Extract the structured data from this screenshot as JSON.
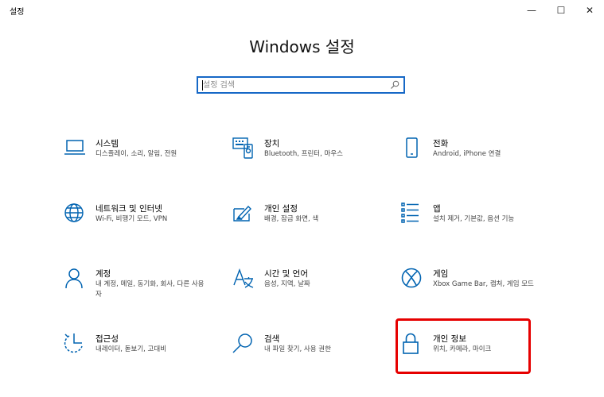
{
  "window": {
    "title": "설정",
    "minimize_glyph": "—",
    "maximize_glyph": "☐",
    "close_glyph": "✕"
  },
  "header": {
    "title": "Windows 설정"
  },
  "search": {
    "placeholder": "설정 검색",
    "value": ""
  },
  "colors": {
    "accent": "#1668c6",
    "highlight": "#e60000"
  },
  "tiles": [
    {
      "icon": "laptop-icon",
      "title": "시스템",
      "desc": "디스플레이, 소리, 알림, 전원"
    },
    {
      "icon": "keyboard-icon",
      "title": "장치",
      "desc": "Bluetooth, 프린터, 마우스"
    },
    {
      "icon": "phone-icon",
      "title": "전화",
      "desc": "Android, iPhone 연결"
    },
    {
      "icon": "globe-icon",
      "title": "네트워크 및 인터넷",
      "desc": "Wi-Fi, 비행기 모드, VPN"
    },
    {
      "icon": "paint-icon",
      "title": "개인 설정",
      "desc": "배경, 잠금 화면, 색"
    },
    {
      "icon": "apps-list-icon",
      "title": "앱",
      "desc": "설치 제거, 기본값, 옵션 기능"
    },
    {
      "icon": "person-icon",
      "title": "계정",
      "desc": "내 계정, 메일, 동기화, 회사, 다른 사용자"
    },
    {
      "icon": "language-icon",
      "title": "시간 및 언어",
      "desc": "음성, 지역, 날짜"
    },
    {
      "icon": "xbox-icon",
      "title": "게임",
      "desc": "Xbox Game Bar, 캡처, 게임 모드"
    },
    {
      "icon": "accessibility-icon",
      "title": "접근성",
      "desc": "내레이터, 돋보기, 고대비"
    },
    {
      "icon": "search-icon",
      "title": "검색",
      "desc": "내 파일 찾기, 사용 권한"
    },
    {
      "icon": "lock-icon",
      "title": "개인 정보",
      "desc": "위치, 카메라, 마이크"
    }
  ]
}
